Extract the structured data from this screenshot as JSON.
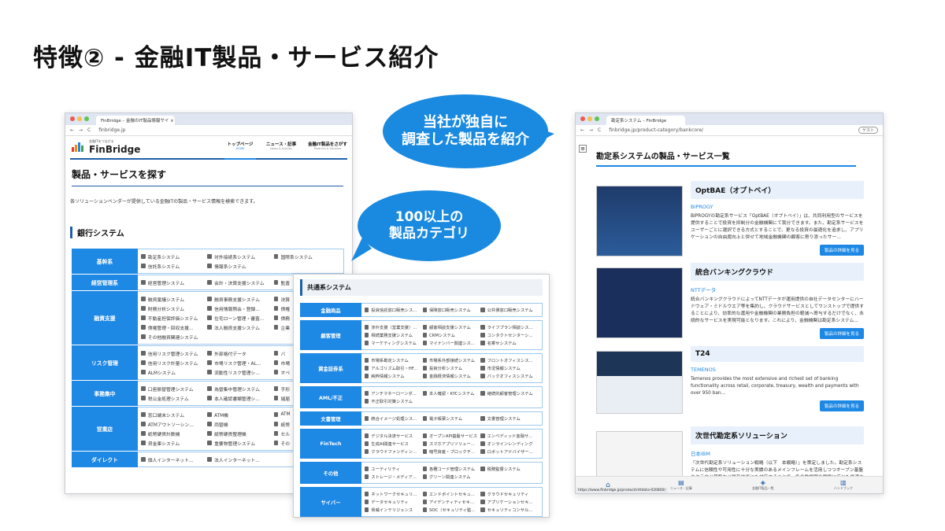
{
  "slide_title": "特徴② - 金融IT製品・サービス紹介",
  "bubble1": {
    "line1": "当社が独自に",
    "line2": "調査した製品を紹介"
  },
  "bubble2": {
    "line1": "100以上の",
    "line2": "製品カテゴリ"
  },
  "left_window": {
    "tab_title": "FinBridge – 金融のIT製品情報サイ ×",
    "url": "finbridge.jp",
    "logo_tag": "金融ITをつなげる",
    "logo": "FinBridge",
    "nav": [
      {
        "label": "トップページ",
        "sub": "HOME"
      },
      {
        "label": "ニュース・記事",
        "sub": "News & Articles"
      },
      {
        "label": "金融IT製品をさがす",
        "sub": "Products & Services"
      }
    ],
    "page_heading": "製品・サービスを探す",
    "intro": "各ソリューションベンダーが提供している金融ITの製品・サービス情報を検索できます。",
    "section": "銀行システム",
    "categories": [
      {
        "label": "基幹系",
        "items": [
          "勘定系システム",
          "対外接続系システム",
          "国際系システム",
          "信託系システム",
          "情報系システム",
          ""
        ]
      },
      {
        "label": "経営管理系",
        "items": [
          "経営管理システム",
          "会計・決算支援システム",
          "監査"
        ]
      },
      {
        "label": "融資支援",
        "items": [
          "融資稟議システム",
          "融資事務支援システム",
          "決算",
          "財務分析システム",
          "信用情報照会・登録...",
          "債権",
          "不動産担保評価システム",
          "住宅ローン管理・審査...",
          "債務",
          "債権管理・回収支援...",
          "法人融資支援システム",
          "企業",
          "その他融資関連システム",
          "",
          ""
        ]
      },
      {
        "label": "リスク管理",
        "items": [
          "信用リスク管理システム",
          "外部格付データ",
          "バ",
          "信用リスク計量システム",
          "市場リスク管理・AL...",
          "市場",
          "ALMシステム",
          "流動性リスク管理シ...",
          "オペ"
        ]
      },
      {
        "label": "事務集中",
        "items": [
          "口座振替管理システム",
          "為替集中管理システム",
          "手形",
          "税公金処理システム",
          "本人確認書類管理シ...",
          "諸届"
        ]
      },
      {
        "label": "営業店",
        "items": [
          "窓口端末システム",
          "ATM機",
          "ATM",
          "ATMアウトソーシン...",
          "両替機",
          "紙幣",
          "紙幣硬貨計数機",
          "紙幣硬貨整理機",
          "セル",
          "貸金庫システム",
          "重要物管理システム",
          "その"
        ]
      },
      {
        "label": "ダイレクト",
        "items": [
          "個人インターネット...",
          "法人インターネット...",
          ""
        ]
      }
    ]
  },
  "middle_window": {
    "section": "共通系システム",
    "categories": [
      {
        "label": "金融商品",
        "items": [
          "投資信託窓口販売シス...",
          "保険窓口販売システム",
          "公共債窓口販売システム"
        ]
      },
      {
        "label": "顧客管理",
        "items": [
          "渉外支援（営業支援）...",
          "顧客相談支援システム",
          "ライフプラン相談シス...",
          "相続業務支援システム",
          "CRMシステム",
          "コンタクトセンターシ...",
          "マーケティングシステム",
          "マイナンバー関連シス...",
          "名寄せシステム"
        ]
      },
      {
        "label": "資金証券系",
        "items": [
          "市場系勘定システム",
          "市場系外部接続システム",
          "フロントオフィスシス...",
          "アルゴリズム取引・HF...",
          "投資分析システム",
          "市況情報システム",
          "純粋情報システム",
          "金融経済情報システム",
          "バックオフィスシステム"
        ]
      },
      {
        "label": "AML/不正",
        "items": [
          "アンチマネーローンダ...",
          "本人確認・KYCシステム",
          "継続的顧客管理システム",
          "不正取引対策システム",
          "",
          ""
        ]
      },
      {
        "label": "文書管理",
        "items": [
          "統合イメージ処理シス...",
          "電子帳票システム",
          "文書管理システム"
        ]
      },
      {
        "label": "FinTech",
        "items": [
          "デジタル決済サービス",
          "オープンAPI基盤サービス",
          "エンベディッド金融サ...",
          "生成AI関連サービス",
          "スマホアプリソリュー...",
          "オンラインレンディング",
          "クラウドファンディン...",
          "暗号資産・ブロックチ...",
          "ロボットアドバイザー..."
        ]
      },
      {
        "label": "その他",
        "items": [
          "ユーティリティ",
          "各種コード管理システム",
          "税務監督システム",
          "ストレージ・メディア...",
          "グリーン関連システム",
          ""
        ]
      },
      {
        "label": "サイバー",
        "items": [
          "ネットワークセキュリ...",
          "エンドポイントセキュ...",
          "クラウドセキュリティ",
          "データセキュリティ",
          "アイデンティティセキ...",
          "アプリケーションセキ...",
          "脅威インテリジェンス",
          "SOC（セキュリティ監...",
          "セキュリティコンサル..."
        ]
      }
    ]
  },
  "right_window": {
    "tab_title": "勘定系システム – FinBridge",
    "url": "finbridge.jp/product-category/bankcore/",
    "guest": "ゲスト",
    "page_heading": "勘定系システムの製品・サービス一覧",
    "products": [
      {
        "title": "OptBAE（オプトベイ）",
        "vendor": "BIPROGY",
        "desc": "BIPROGYの勘定系サービス「OptBAE（オプトベイ）」は、共同利用型のサービスを提供することで投資を抑制分の金融機関にて我分できます。また、勘定系サービスをユーザーごとに選択できる方式とすることで、更なる投資の最適化を追求し、アプリケーションの自由度向上と併せて地域金融機関の顧客に寄り添ったサー...",
        "button": "製品の詳細を見る"
      },
      {
        "title": "統合バンキングクラウド",
        "vendor": "NTTデータ",
        "desc": "統合バンキングクラウドによってNTTデータが運用提供の自社データセンターにハードウェア・ミドルウエア等を集約し、クラウドサービスとしてワンストップで提供することにより、効率的な運用や金融機関の業務負担の軽減へ寄与するだけでなく、永続的なサービスを実現可能となります。これにより、金融機関は勘定系システム...",
        "button": "製品の詳細を見る"
      },
      {
        "title": "T24",
        "vendor": "TEMENOS",
        "desc": "Temenos provides the most extensive and richest set of banking functionality across retail, corporate, treasury, wealth and payments with over 950 ban...",
        "button": "製品の詳細を見る"
      },
      {
        "title": "次世代勘定系ソリューション",
        "vendor": "日本IBM",
        "desc": "「次世代勘定系ソリューション戦略（以下　本戦略）」を策定しました。勘定系システムに信頼性や可用性に十分な実績のあるメインフレームを活用しつつオープン基盤やクラウド基盤など最新技術にも対応することで、各金融機関の戦略に応じた最適な選択・組み合",
        "button": ""
      }
    ],
    "status_url": "https://www.finbridge.jp/product/nttdata-020800/",
    "bottom_nav": [
      "",
      "ニュース・記事",
      "金融IT製品一覧",
      "ハンドブック"
    ]
  },
  "colors": {
    "accent": "#1e88e5",
    "bubble": "#1a8ae0",
    "heading_bar": "#1e5fa8"
  }
}
